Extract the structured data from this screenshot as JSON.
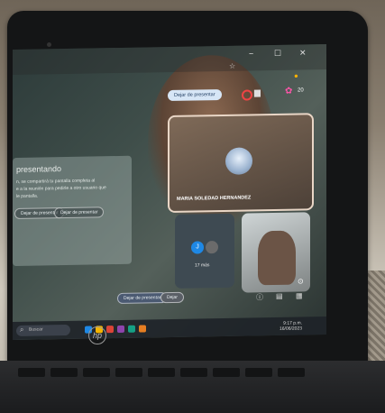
{
  "top_bar": {
    "icons": [
      "window-minimize-icon",
      "window-maximize-icon",
      "window-close-icon"
    ],
    "count": "20"
  },
  "presentation_panel": {
    "title": "presentando",
    "line1": "n, se compartirá tu pantalla completa al",
    "line2": "e a la reunión para pedirle a otro usuario que",
    "line3": "le pantalla.",
    "btn_left": "Dejar de presentar",
    "btn_right": "Dejar de presentar"
  },
  "call": {
    "stop_presenting": "Dejar de presentar",
    "main_participant": "MARIA SOLEDAD HERNANDEZ",
    "others_label": "17 más",
    "others_initial": "J",
    "taskbar_stop": "Dejar de presentar",
    "taskbar_share": "Dejar"
  },
  "search": {
    "placeholder": "Buscar"
  },
  "tray": {
    "time": "9:17 p.m.",
    "date": "16/06/2023"
  },
  "colors": {
    "accent": "#d7e6f6",
    "tile_border": "#e9d6c6",
    "avatar_j": "#1e88e5"
  }
}
